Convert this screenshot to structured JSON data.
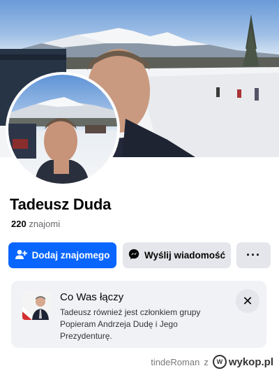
{
  "profile": {
    "name": "Tadeusz Duda",
    "friends_count": "220",
    "friends_label": "znajomi"
  },
  "actions": {
    "add_friend_label": "Dodaj znajomego",
    "message_label": "Wyślij wiadomość",
    "more_label": "···"
  },
  "mutual_card": {
    "title": "Co Was łączy",
    "text": "Tadeusz również jest członkiem grupy Popieram Andrzeja Dudę i Jego Prezydenturę.",
    "close_icon": "close-icon"
  },
  "footer": {
    "author": "tindeRoman",
    "separator": "z",
    "site": "wykop.pl"
  },
  "colors": {
    "primary": "#0866ff",
    "secondary_button": "#e4e6eb",
    "card_bg": "#f0f2f5"
  }
}
